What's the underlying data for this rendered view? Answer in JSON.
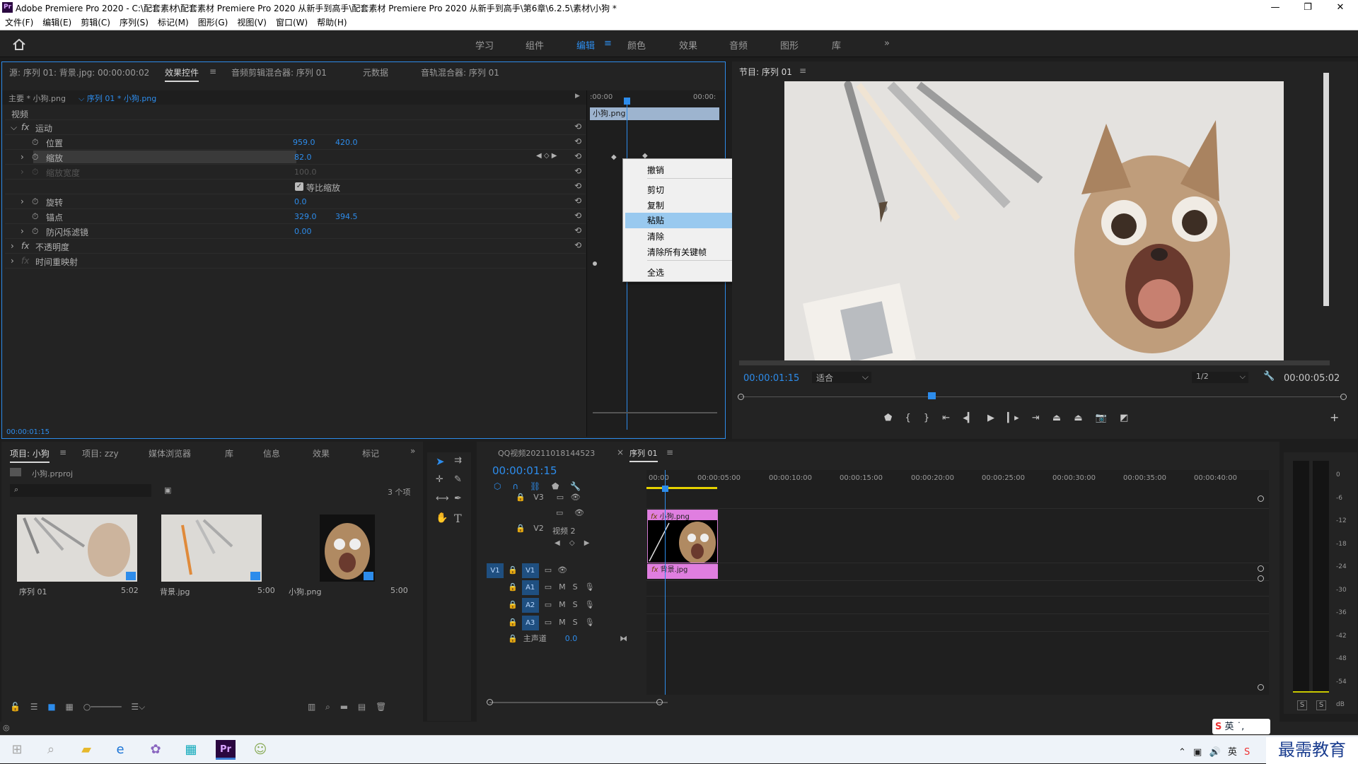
{
  "app": {
    "icon": "Pr",
    "title": "Adobe Premiere Pro 2020 - C:\\配套素材\\配套素材 Premiere Pro 2020 从新手到高手\\配套素材 Premiere Pro 2020 从新手到高手\\第6章\\6.2.5\\素材\\小狗 *",
    "win": {
      "min": "—",
      "max": "❐",
      "close": "✕"
    }
  },
  "menu": [
    "文件(F)",
    "编辑(E)",
    "剪辑(C)",
    "序列(S)",
    "标记(M)",
    "图形(G)",
    "视图(V)",
    "窗口(W)",
    "帮助(H)"
  ],
  "workspaces": {
    "items": [
      "学习",
      "组件",
      "编辑",
      "颜色",
      "效果",
      "音频",
      "图形",
      "库"
    ],
    "more": "»"
  },
  "ec": {
    "tabs": [
      "源: 序列 01: 背景.jpg: 00:00:00:02",
      "效果控件",
      "音频剪辑混合器: 序列 01",
      "元数据",
      "音轨混合器: 序列 01"
    ],
    "source": "主要 * 小狗.png",
    "clip": "序列 01 * 小狗.png",
    "t_start": ":00:00",
    "t_end": "00:00:",
    "clip_name": "小狗.png",
    "video": "视频",
    "fx_motion": "运动",
    "pos_label": "位置",
    "pos_x": "959.0",
    "pos_y": "420.0",
    "scale_label": "缩放",
    "scale_val": "82.0",
    "scale_w_label": "缩放宽度",
    "scale_w_val": "100.0",
    "uniform": "等比缩放",
    "rot_label": "旋转",
    "rot_val": "0.0",
    "anchor_label": "锚点",
    "anchor_x": "329.0",
    "anchor_y": "394.5",
    "flicker_label": "防闪烁滤镜",
    "flicker_val": "0.00",
    "opacity": "不透明度",
    "timeremap": "时间重映射",
    "timecode": "00:00:01:15"
  },
  "ctx_menu": {
    "undo": "撤销",
    "cut": "剪切",
    "copy": "复制",
    "paste": "粘贴",
    "clear": "清除",
    "clear_all": "清除所有关键帧",
    "select_all": "全选"
  },
  "program": {
    "title": "节目: 序列 01",
    "timecode": "00:00:01:15",
    "fit": "适合",
    "res": "1/2",
    "duration": "00:00:05:02"
  },
  "project": {
    "tabs": [
      "项目: 小狗",
      "项目: zzy",
      "媒体浏览器",
      "库",
      "信息",
      "效果",
      "标记"
    ],
    "file": "小狗.prproj",
    "count": "3 个项",
    "items": [
      {
        "name": "序列 01",
        "dur": "5:02"
      },
      {
        "name": "背景.jpg",
        "dur": "5:00"
      },
      {
        "name": "小狗.png",
        "dur": "5:00"
      }
    ]
  },
  "timeline": {
    "tabs": [
      "QQ视频20211018144523",
      "序列 01"
    ],
    "timecode": "00:00:01:15",
    "ruler": [
      "00:00",
      "00:00:05:00",
      "00:00:10:00",
      "00:00:15:00",
      "00:00:20:00",
      "00:00:25:00",
      "00:00:30:00",
      "00:00:35:00",
      "00:00:40:00"
    ],
    "tracks": {
      "v3": "V3",
      "v2": "V2",
      "v2name": "视频 2",
      "v1": "V1",
      "a1": "A1",
      "a2": "A2",
      "a3": "A3",
      "master": "主声道",
      "master_val": "0.0",
      "m": "M",
      "s": "S"
    },
    "clip_top": "小狗.png",
    "clip_bottom": "背景.jpg"
  },
  "meter": {
    "scale": [
      "0",
      "-6",
      "-12",
      "-18",
      "-24",
      "-30",
      "-36",
      "-42",
      "-48",
      "-54",
      "dB"
    ],
    "solo": "S"
  },
  "ime": {
    "label": "英"
  },
  "watermark": "最需教育"
}
